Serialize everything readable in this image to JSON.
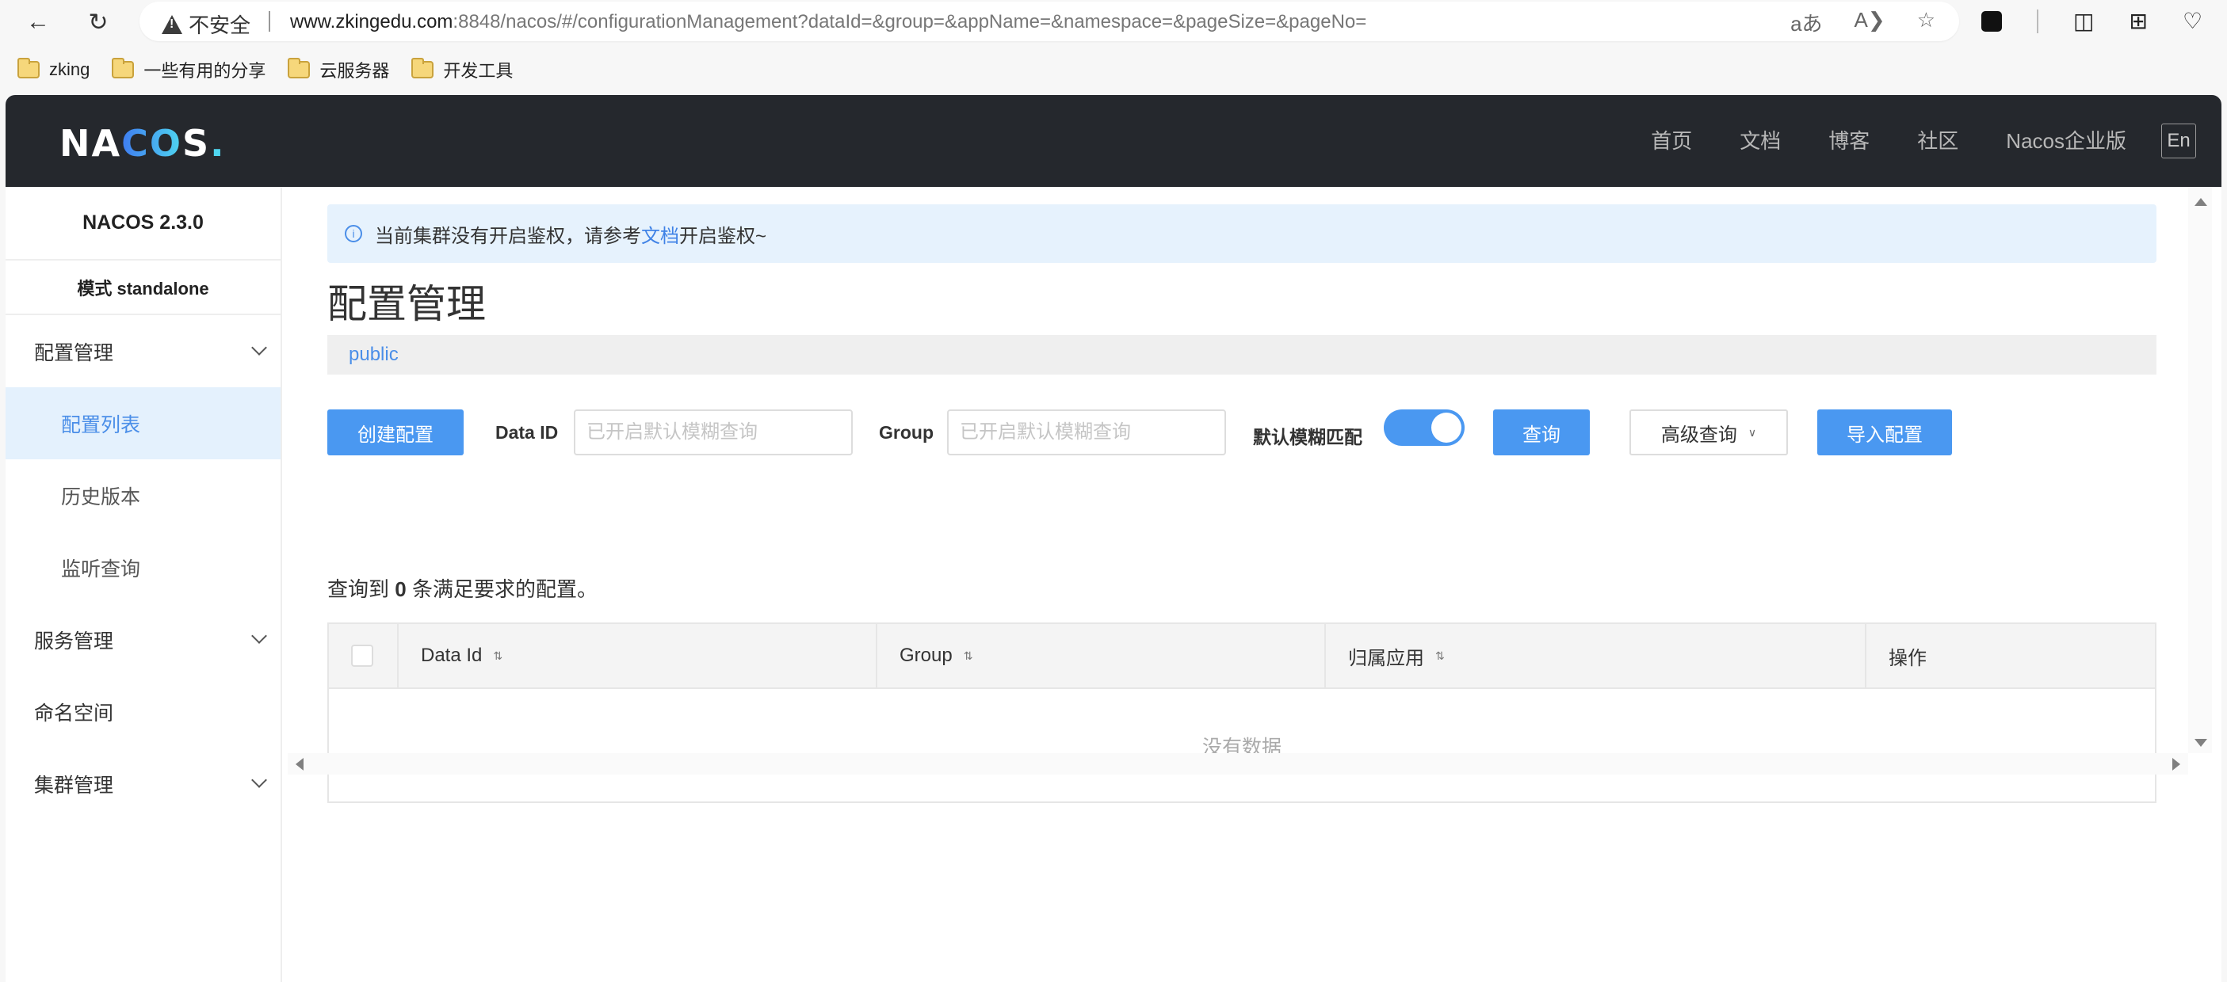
{
  "browser": {
    "security_label": "不安全",
    "url_host": "www.zkingedu.com",
    "url_rest": ":8848/nacos/#/configurationManagement?dataId=&group=&appName=&namespace=&pageSize=&pageNo=",
    "bookmarks": [
      {
        "label": "zking"
      },
      {
        "label": "一些有用的分享"
      },
      {
        "label": "云服务器"
      },
      {
        "label": "开发工具"
      }
    ]
  },
  "header": {
    "logo_n": "NA",
    "logo_co": "CO",
    "logo_s": "S",
    "logo_dot": ".",
    "nav": [
      {
        "label": "首页"
      },
      {
        "label": "文档"
      },
      {
        "label": "博客"
      },
      {
        "label": "社区"
      },
      {
        "label": "Nacos企业版"
      }
    ],
    "lang": "En"
  },
  "sidebar": {
    "version": "NACOS 2.3.0",
    "mode": "模式 standalone",
    "items": [
      {
        "label": "配置管理",
        "expandable": true
      },
      {
        "label": "配置列表",
        "active": true
      },
      {
        "label": "历史版本"
      },
      {
        "label": "监听查询"
      },
      {
        "label": "服务管理",
        "expandable": true
      },
      {
        "label": "命名空间"
      },
      {
        "label": "集群管理",
        "expandable": true
      }
    ]
  },
  "main": {
    "alert": {
      "before": "当前集群没有开启鉴权，请参考",
      "link": "文档",
      "after": "开启鉴权~"
    },
    "title": "配置管理",
    "namespace": "public",
    "toolbar": {
      "create_label": "创建配置",
      "data_id_label": "Data ID",
      "data_id_placeholder": "已开启默认模糊查询",
      "data_id_value": "",
      "group_label": "Group",
      "group_placeholder": "已开启默认模糊查询",
      "group_value": "",
      "fuzzy_label": "默认模糊匹配",
      "fuzzy_enabled": true,
      "query_label": "查询",
      "advanced_label": "高级查询",
      "import_label": "导入配置"
    },
    "result": {
      "prefix": "查询到",
      "count": "0",
      "suffix": "条满足要求的配置。"
    },
    "table": {
      "columns": [
        {
          "label": "Data Id",
          "sortable": true
        },
        {
          "label": "Group",
          "sortable": true
        },
        {
          "label": "归属应用",
          "sortable": true
        },
        {
          "label": "操作",
          "sortable": false
        }
      ],
      "rows": [],
      "empty_text": "没有数据"
    }
  }
}
